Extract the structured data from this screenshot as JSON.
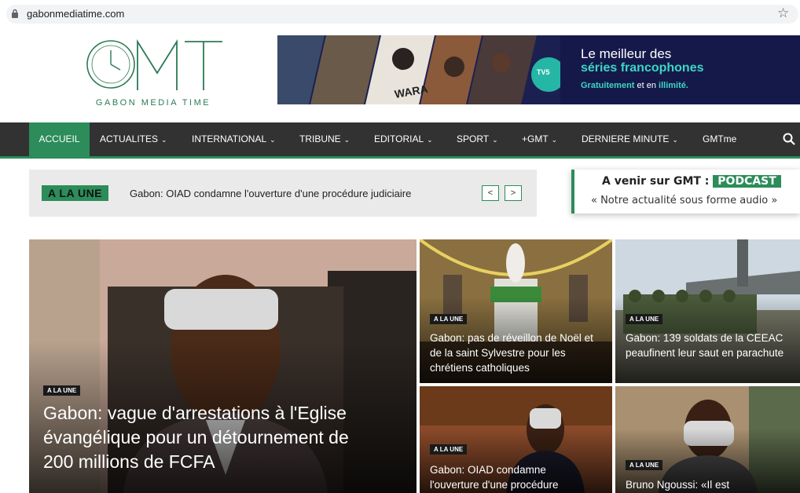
{
  "browser": {
    "url": "gabonmediatime.com"
  },
  "logo": {
    "letters": "GMT",
    "subtitle": "GABON MEDIA TIME"
  },
  "banner": {
    "line1": "Le meilleur des",
    "line2": "séries francophones",
    "line3a": "Gratuitement",
    "line3b": " et en ",
    "line3c": "illimité.",
    "brand": "TV5 MONDE PLUS",
    "poster_text": "WARA"
  },
  "nav": {
    "items": [
      {
        "label": "ACCUEIL",
        "chevron": ""
      },
      {
        "label": "ACTUALITES",
        "chevron": "⌄"
      },
      {
        "label": "INTERNATIONAL",
        "chevron": "⌄"
      },
      {
        "label": "TRIBUNE",
        "chevron": "⌄"
      },
      {
        "label": "EDITORIAL",
        "chevron": "⌄"
      },
      {
        "label": "SPORT",
        "chevron": "⌄"
      },
      {
        "label": "+GMT",
        "chevron": "⌄"
      },
      {
        "label": "DERNIERE MINUTE",
        "chevron": "⌄"
      },
      {
        "label": "GMTme",
        "chevron": ""
      }
    ]
  },
  "ticker": {
    "tag": "A LA UNE",
    "headline": "Gabon: OIAD condamne l'ouverture d'une procédure judiciaire",
    "prev": "<",
    "next": ">"
  },
  "podcast": {
    "title": "A venir sur GMT : ",
    "badge": "PODCAST",
    "subtitle": "« Notre actualité sous forme audio »"
  },
  "cards": [
    {
      "badge": "A LA UNE",
      "title": "Gabon: vague d'arrestations à l'Eglise évangélique pour un détournement de 200 millions de FCFA"
    },
    {
      "badge": "A LA UNE",
      "title": "Gabon: pas de réveillon de Noël et de la saint Sylvestre pour les chrétiens catholiques"
    },
    {
      "badge": "A LA UNE",
      "title": "Gabon: 139 soldats de la CEEAC peaufinent leur saut en parachute"
    },
    {
      "badge": "A LA UNE",
      "title": "Gabon: OIAD condamne l'ouverture d'une procédure"
    },
    {
      "badge": "A LA UNE",
      "title": "Bruno Ngoussi: «Il est"
    }
  ],
  "colors": {
    "accent": "#2c8c5a",
    "nav_bg": "#323232",
    "banner_bg": "#15194a"
  }
}
